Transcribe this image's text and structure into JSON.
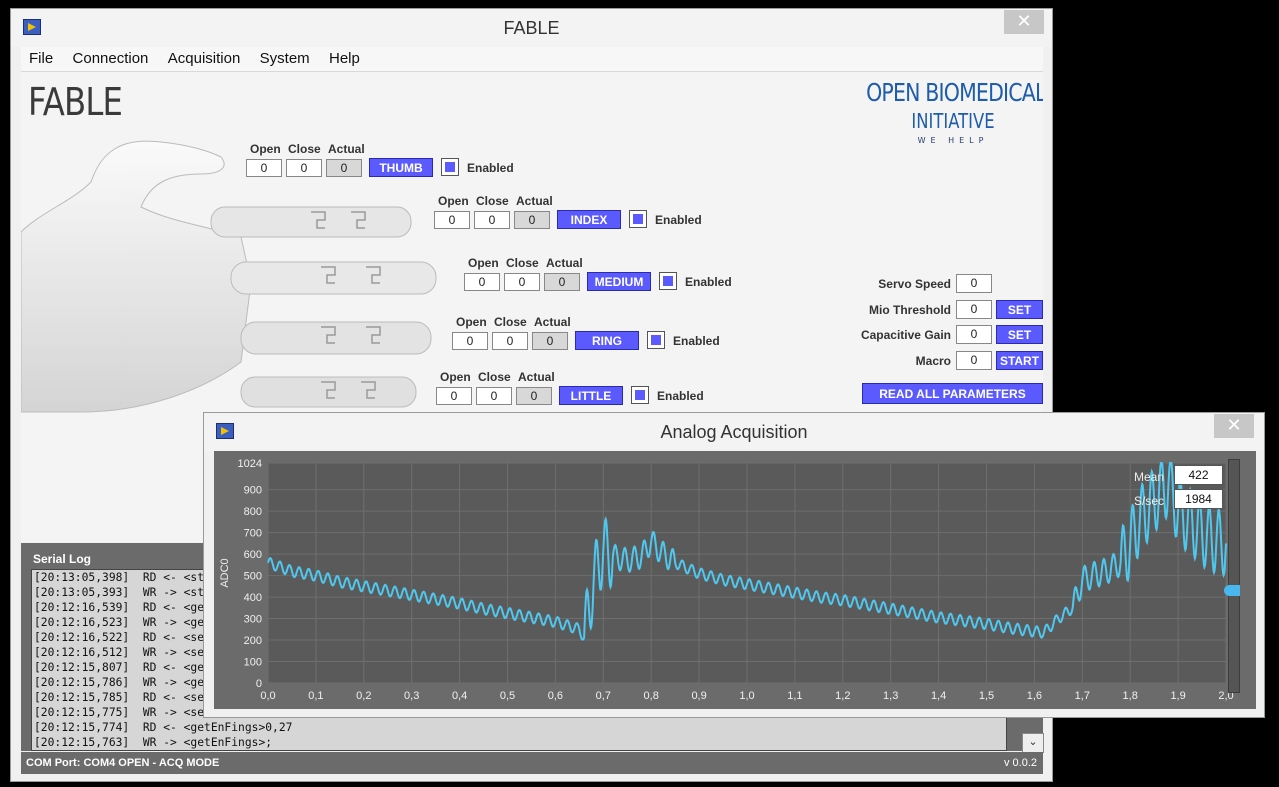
{
  "main_window": {
    "title": "FABLE",
    "close": "✕"
  },
  "menu": [
    "File",
    "Connection",
    "Acquisition",
    "System",
    "Help"
  ],
  "brand": "FABLE",
  "logo": {
    "line1": "OPEN BIOMEDICAL",
    "line2": "INITIATIVE",
    "line3": "WE HELP"
  },
  "colors": {
    "accent": "#5a5aff",
    "logo": "#1f5caa",
    "signal": "#4fc8f0"
  },
  "finger_headers": {
    "open": "Open",
    "close": "Close",
    "actual": "Actual",
    "enabled": "Enabled"
  },
  "fingers": [
    {
      "name": "THUMB",
      "open": "0",
      "close": "0",
      "actual": "0",
      "enabled": true
    },
    {
      "name": "INDEX",
      "open": "0",
      "close": "0",
      "actual": "0",
      "enabled": true
    },
    {
      "name": "MEDIUM",
      "open": "0",
      "close": "0",
      "actual": "0",
      "enabled": true
    },
    {
      "name": "RING",
      "open": "0",
      "close": "0",
      "actual": "0",
      "enabled": true
    },
    {
      "name": "LITTLE",
      "open": "0",
      "close": "0",
      "actual": "0",
      "enabled": true
    }
  ],
  "params": [
    {
      "label": "Servo Speed",
      "value": "0",
      "button": ""
    },
    {
      "label": "Mio Threshold",
      "value": "0",
      "button": "SET"
    },
    {
      "label": "Capacitive Gain",
      "value": "0",
      "button": "SET"
    },
    {
      "label": "Macro",
      "value": "0",
      "button": "START"
    }
  ],
  "read_all": "READ ALL PARAMETERS",
  "serial_log": {
    "title": "Serial Log",
    "lines": [
      "[20:13:05,398]  RD <- <st",
      "[20:13:05,393]  WR -> <st",
      "[20:12:16,539]  RD <- <ge",
      "[20:12:16,523]  WR -> <ge",
      "[20:12:16,522]  RD <- <se",
      "[20:12:16,512]  WR -> <se",
      "[20:12:15,807]  RD <- <ge",
      "[20:12:15,786]  WR -> <ge",
      "[20:12:15,785]  RD <- <se",
      "[20:12:15,775]  WR -> <se",
      "[20:12:15,774]  RD <- <getEnFings>0,27",
      "[20:12:15,763]  WR -> <getEnFings>;"
    ],
    "scroll_down": "⌄"
  },
  "status": {
    "left": "COM Port: COM4 OPEN - ACQ MODE",
    "right": "v 0.0.2"
  },
  "acq_window": {
    "title": "Analog Acquisition",
    "close": "✕",
    "mean_label": "Mean",
    "mean": "422",
    "sps_label": "S/sec",
    "sps": "1984"
  },
  "chart_data": {
    "type": "line",
    "ylabel": "ADC0",
    "ylim": [
      0,
      1024
    ],
    "xlim": [
      0,
      2.0
    ],
    "y_ticks": [
      "0",
      "100",
      "200",
      "300",
      "400",
      "500",
      "600",
      "700",
      "800",
      "900",
      "1024"
    ],
    "y_tick_values": [
      0,
      100,
      200,
      300,
      400,
      500,
      600,
      700,
      800,
      900,
      1024
    ],
    "x_ticks": [
      "0,0",
      "0,1",
      "0,2",
      "0,3",
      "0,4",
      "0,5",
      "0,6",
      "0,7",
      "0,8",
      "0,9",
      "1,0",
      "1,1",
      "1,2",
      "1,3",
      "1,4",
      "1,5",
      "1,6",
      "1,7",
      "1,8",
      "1,9",
      "2,0"
    ],
    "x_tick_values": [
      0,
      0.1,
      0.2,
      0.3,
      0.4,
      0.5,
      0.6,
      0.7,
      0.8,
      0.9,
      1.0,
      1.1,
      1.2,
      1.3,
      1.4,
      1.5,
      1.6,
      1.7,
      1.8,
      1.9,
      2.0
    ],
    "grid": true,
    "series": [
      {
        "x": [
          0,
          0.05,
          0.1,
          0.15,
          0.2,
          0.25,
          0.3,
          0.35,
          0.4,
          0.45,
          0.5,
          0.55,
          0.6,
          0.65,
          0.66,
          0.68,
          0.7,
          0.72,
          0.75,
          0.78,
          0.8,
          0.82,
          0.85,
          0.9,
          0.95,
          1.0,
          1.05,
          1.1,
          1.15,
          1.2,
          1.25,
          1.3,
          1.35,
          1.4,
          1.45,
          1.5,
          1.55,
          1.6,
          1.62,
          1.65,
          1.68,
          1.7,
          1.72,
          1.75,
          1.78,
          1.8,
          1.82,
          1.84,
          1.86,
          1.88,
          1.9,
          1.92,
          1.94,
          1.96,
          1.98,
          2.0
        ],
        "y": [
          560,
          520,
          500,
          470,
          450,
          430,
          410,
          390,
          370,
          345,
          325,
          305,
          285,
          250,
          210,
          480,
          620,
          590,
          570,
          590,
          660,
          610,
          560,
          510,
          480,
          460,
          440,
          420,
          400,
          385,
          365,
          345,
          325,
          305,
          290,
          275,
          255,
          240,
          235,
          300,
          350,
          480,
          500,
          520,
          560,
          650,
          760,
          820,
          880,
          930,
          800,
          760,
          720,
          680,
          660,
          650
        ]
      }
    ]
  }
}
